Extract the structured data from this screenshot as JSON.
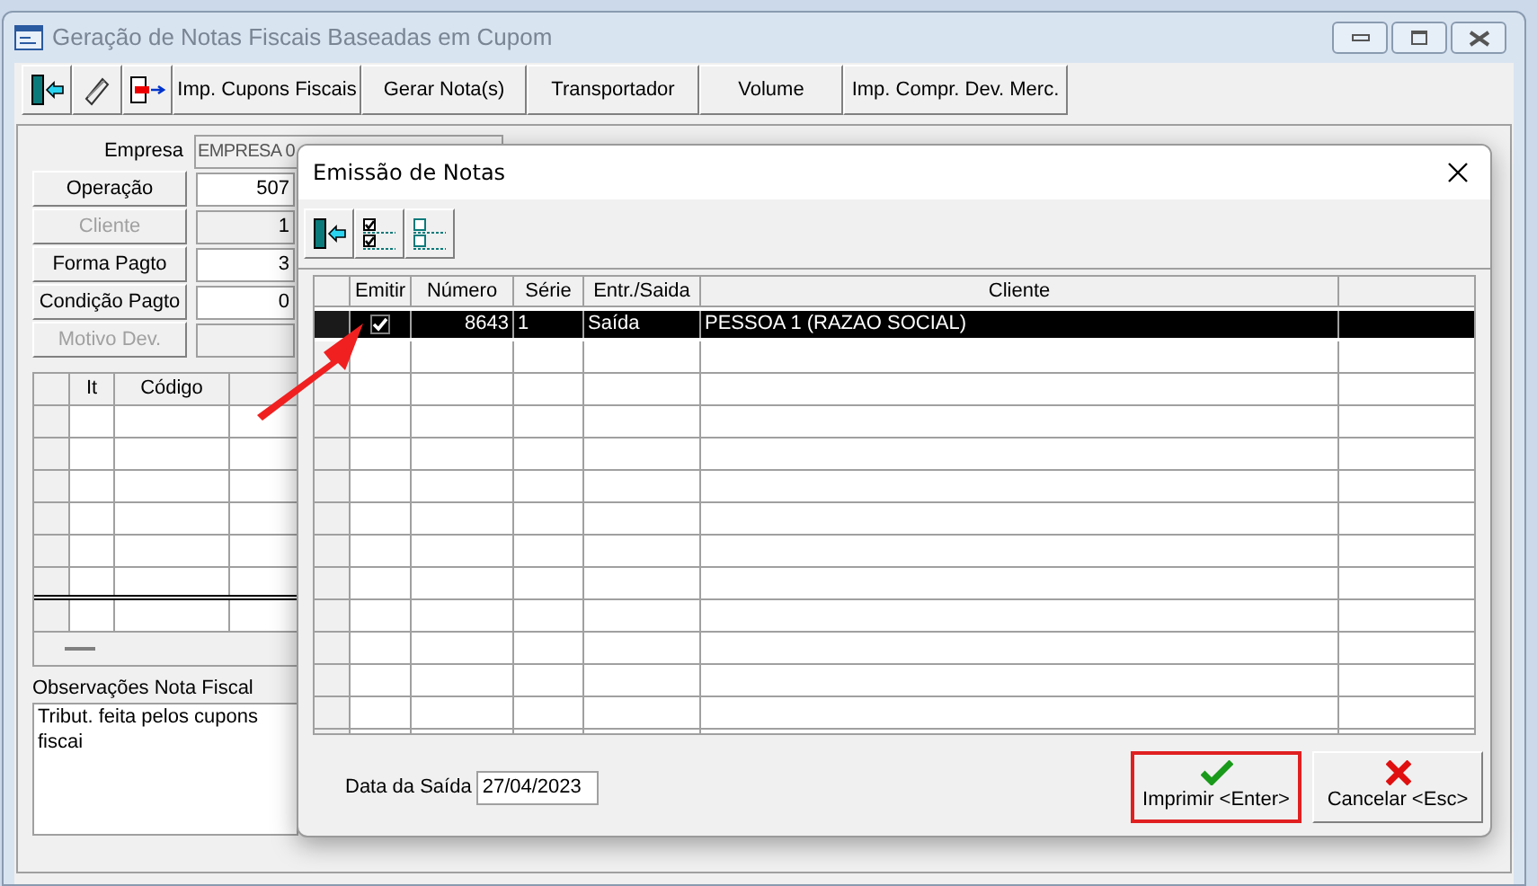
{
  "window": {
    "title": "Geração de Notas Fiscais Baseadas em Cupom"
  },
  "toolbar": {
    "icon_buttons": [
      {
        "kind": "exit"
      },
      {
        "kind": "eraser"
      },
      {
        "kind": "export"
      }
    ],
    "buttons": [
      "Imp. Cupons Fiscais",
      "Gerar Nota(s)",
      "Transportador",
      "Volume",
      "Imp. Compr. Dev. Merc."
    ]
  },
  "form": {
    "empresa": {
      "label": "Empresa",
      "value": "EMPRESA 0"
    },
    "fields": [
      {
        "label": "Operação",
        "value": "507",
        "disabled": false
      },
      {
        "label": "Cliente",
        "value": "1",
        "disabled": true
      },
      {
        "label": "Forma Pagto",
        "value": "3",
        "disabled": false
      },
      {
        "label": "Condição Pagto",
        "value": "0",
        "disabled": false
      },
      {
        "label": "Motivo Dev.",
        "disabled": true
      }
    ]
  },
  "items_grid": {
    "columns": [
      "It",
      "Código"
    ]
  },
  "observations": {
    "label": "Observações Nota Fiscal",
    "text": "Tribut. feita pelos cupons fiscai"
  },
  "dialog": {
    "title": "Emissão de Notas",
    "toolbar": [
      {
        "kind": "exit"
      },
      {
        "kind": "check_all"
      },
      {
        "kind": "uncheck_all"
      }
    ],
    "table": {
      "columns": [
        "Emitir",
        "Número",
        "Série",
        "Entr./Saida",
        "Cliente"
      ],
      "rows": [
        {
          "selected": true,
          "checked": true,
          "numero": "8643",
          "serie": "1",
          "tipo": "Saída",
          "cliente": "PESSOA 1 (RAZAO SOCIAL)"
        }
      ]
    },
    "date": {
      "label": "Data da Saída",
      "value": "27/04/2023"
    },
    "buttons": [
      {
        "kind": "confirm",
        "label": "Imprimir <Enter>",
        "highlighted": true
      },
      {
        "kind": "cancel",
        "label": "Cancelar <Esc>",
        "highlighted": false
      }
    ]
  }
}
